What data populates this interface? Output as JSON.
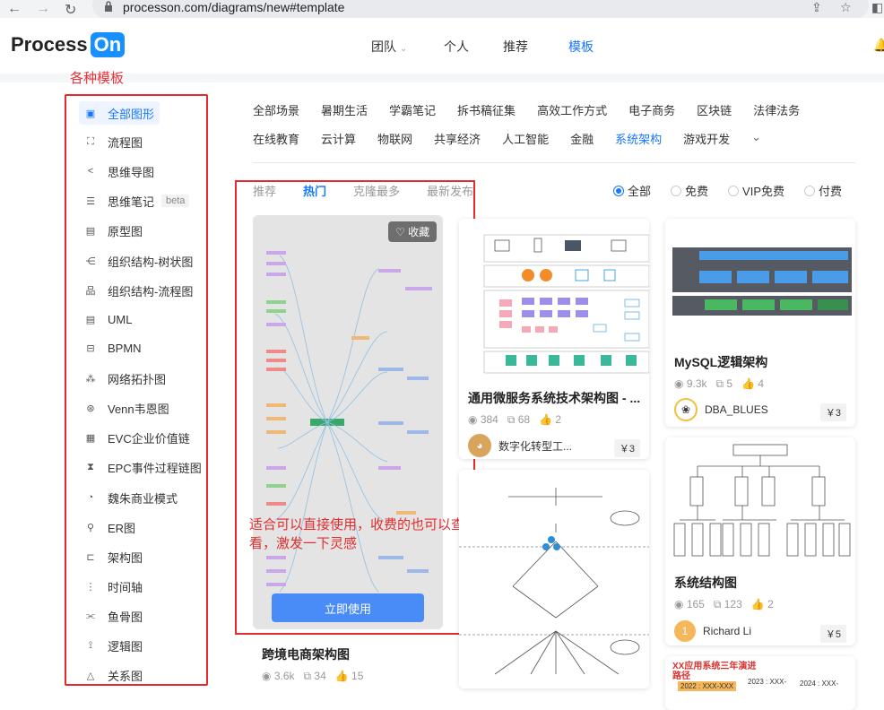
{
  "browser": {
    "url": "processon.com/diagrams/new#template"
  },
  "header": {
    "logo_text": "Process",
    "logo_badge": "On",
    "nav": [
      {
        "label": "团队",
        "has_dropdown": true
      },
      {
        "label": "个人"
      },
      {
        "label": "推荐"
      },
      {
        "label": "模板",
        "active": true
      }
    ]
  },
  "annotations": {
    "sidebar_title": "各种模板",
    "card_note": "适合可以直接使用，收费的也可以查看，激发一下灵感"
  },
  "sidebar": {
    "items": [
      {
        "label": "全部图形",
        "icon": "all-shapes-icon",
        "active": true
      },
      {
        "label": "流程图",
        "icon": "flowchart-icon"
      },
      {
        "label": "思维导图",
        "icon": "mindmap-icon"
      },
      {
        "label": "思维笔记",
        "icon": "notes-icon",
        "badge": "beta"
      },
      {
        "label": "原型图",
        "icon": "prototype-icon"
      },
      {
        "label": "组织结构-树状图",
        "icon": "org-tree-icon"
      },
      {
        "label": "组织结构-流程图",
        "icon": "org-flow-icon"
      },
      {
        "label": "UML",
        "icon": "uml-icon"
      },
      {
        "label": "BPMN",
        "icon": "bpmn-icon"
      },
      {
        "label": "网络拓扑图",
        "icon": "network-icon"
      },
      {
        "label": "Venn韦恩图",
        "icon": "venn-icon"
      },
      {
        "label": "EVC企业价值链",
        "icon": "evc-icon"
      },
      {
        "label": "EPC事件过程链图",
        "icon": "epc-icon"
      },
      {
        "label": "魏朱商业模式",
        "icon": "business-model-icon"
      },
      {
        "label": "ER图",
        "icon": "er-icon"
      },
      {
        "label": "架构图",
        "icon": "architecture-icon"
      },
      {
        "label": "时间轴",
        "icon": "timeline-icon"
      },
      {
        "label": "鱼骨图",
        "icon": "fishbone-icon"
      },
      {
        "label": "逻辑图",
        "icon": "logic-icon"
      },
      {
        "label": "关系图",
        "icon": "relation-icon"
      }
    ]
  },
  "categories": {
    "row1": [
      "全部场景",
      "暑期生活",
      "学霸笔记",
      "拆书稿征集",
      "高效工作方式",
      "电子商务",
      "区块链",
      "法律法务"
    ],
    "row2": [
      "在线教育",
      "云计算",
      "物联网",
      "共享经济",
      "人工智能",
      "金融",
      "系统架构",
      "游戏开发"
    ],
    "active": "系统架构"
  },
  "sort": {
    "tabs": [
      "推荐",
      "热门",
      "克隆最多",
      "最新发布"
    ],
    "active": "热门"
  },
  "filter": {
    "options": [
      "全部",
      "免费",
      "VIP免费",
      "付费"
    ],
    "selected": "全部"
  },
  "cards": {
    "hot": {
      "fav_label": "收藏",
      "use_label": "立即使用",
      "title": "跨境电商架构图",
      "views": "3.6k",
      "clones": "34",
      "likes": "15"
    },
    "c2": {
      "title": "通用微服务系统技术架构图 - ...",
      "views": "384",
      "clones": "68",
      "likes": "2",
      "author": "数字化转型工...",
      "price": "￥3"
    },
    "c3": {
      "title": "MySQL逻辑架构",
      "views": "9.3k",
      "clones": "5",
      "likes": "4",
      "author": "DBA_BLUES",
      "price": "￥3"
    },
    "c5": {
      "title": "系统结构图",
      "views": "165",
      "clones": "123",
      "likes": "2",
      "author": "Richard Li",
      "avatar_letter": "1",
      "price": "￥5"
    },
    "c6": {
      "title": "XX应用系统三年演进路径",
      "years": [
        "2022 : XXX-XXX",
        "2023 : XXX-",
        "2024 : XXX-"
      ]
    }
  }
}
